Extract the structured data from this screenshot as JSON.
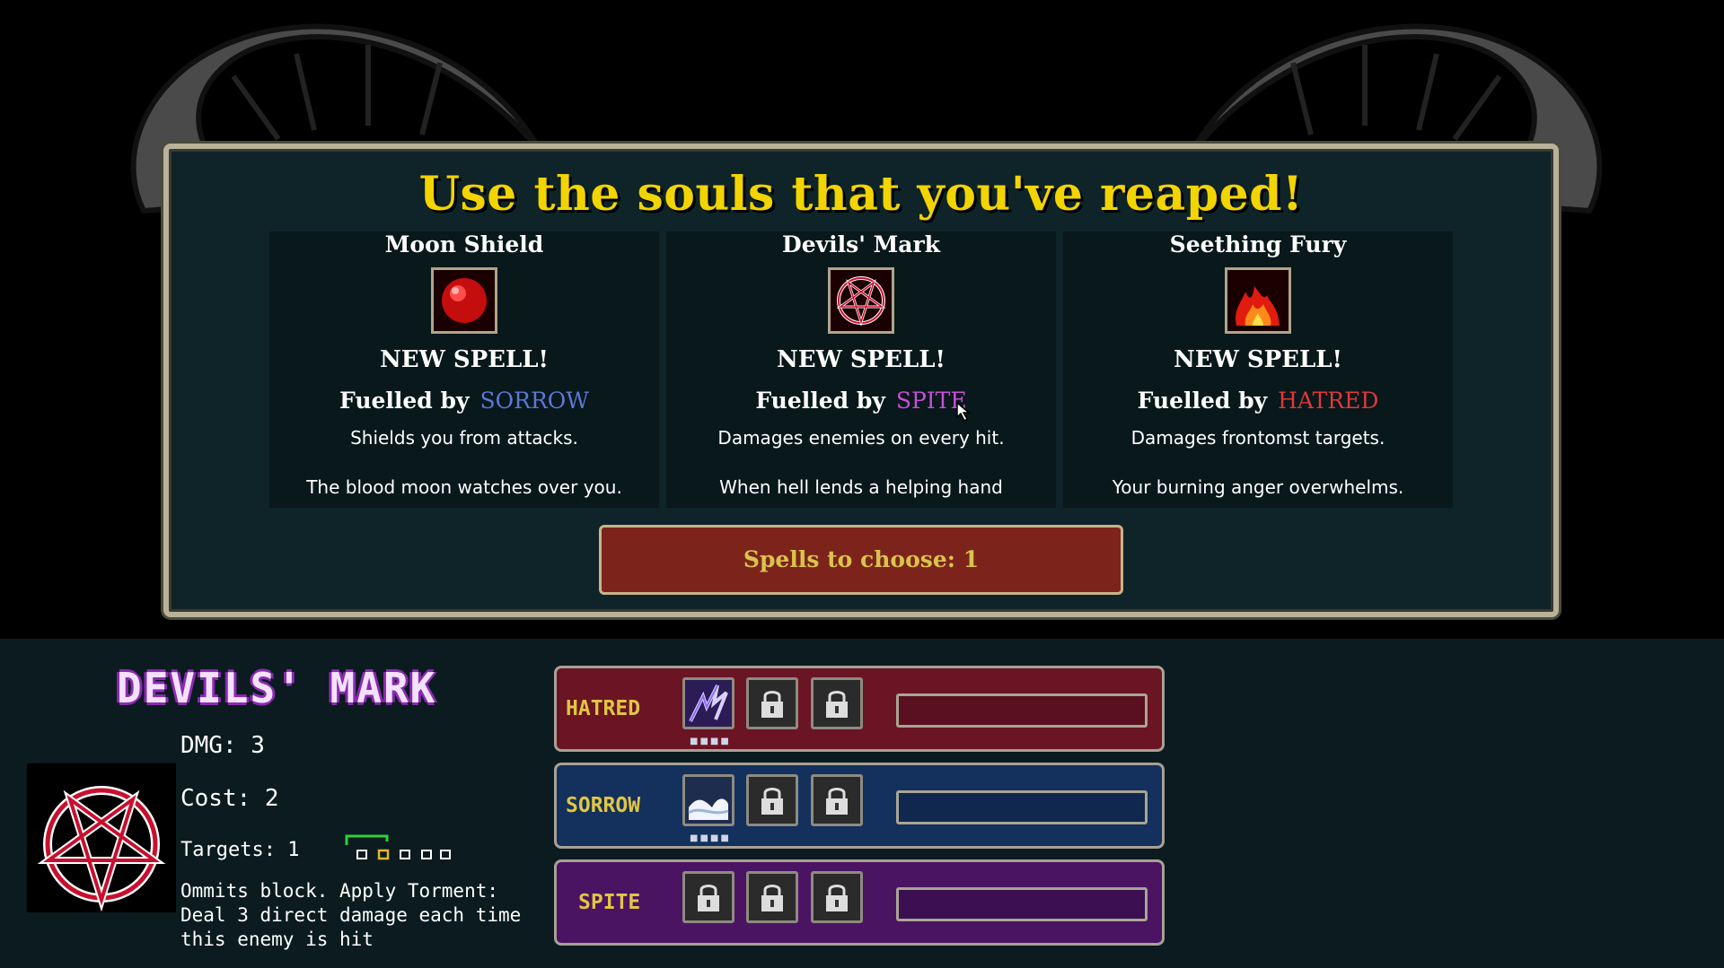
{
  "banner": {
    "title": "Use the souls that you've reaped!",
    "button_label": "Spells to choose: 1"
  },
  "cards": [
    {
      "name": "Moon Shield",
      "icon": "red-orb-icon",
      "status": "NEW SPELL!",
      "fuel_prefix": "Fuelled by",
      "fuel": "SORROW",
      "fuel_color": "#5b78d6",
      "description": "Shields you from attacks.",
      "flavor": "The blood moon watches over you."
    },
    {
      "name": "Devils' Mark",
      "icon": "pentagram-icon",
      "status": "NEW SPELL!",
      "fuel_prefix": "Fuelled by",
      "fuel": "SPITE",
      "fuel_color": "#c84fd8",
      "description": "Damages enemies on every hit.",
      "flavor": "When hell lends a helping hand"
    },
    {
      "name": "Seething Fury",
      "icon": "flame-icon",
      "status": "NEW SPELL!",
      "fuel_prefix": "Fuelled by",
      "fuel": "HATRED",
      "fuel_color": "#e0383a",
      "description": "Damages frontomst targets.",
      "flavor": "Your burning anger overwhelms."
    }
  ],
  "details": {
    "title": "DEVILS' MARK",
    "dmg": "DMG: 3",
    "cost": "Cost: 2",
    "targets": "Targets: 1",
    "description": "Ommits block. Apply Torment: Deal 3 direct damage each time this enemy is hit"
  },
  "rows": [
    {
      "label": "HATRED",
      "color": "#6a1424"
    },
    {
      "label": "SORROW",
      "color": "#14305c"
    },
    {
      "label": "SPITE",
      "color": "#4a1462"
    }
  ]
}
